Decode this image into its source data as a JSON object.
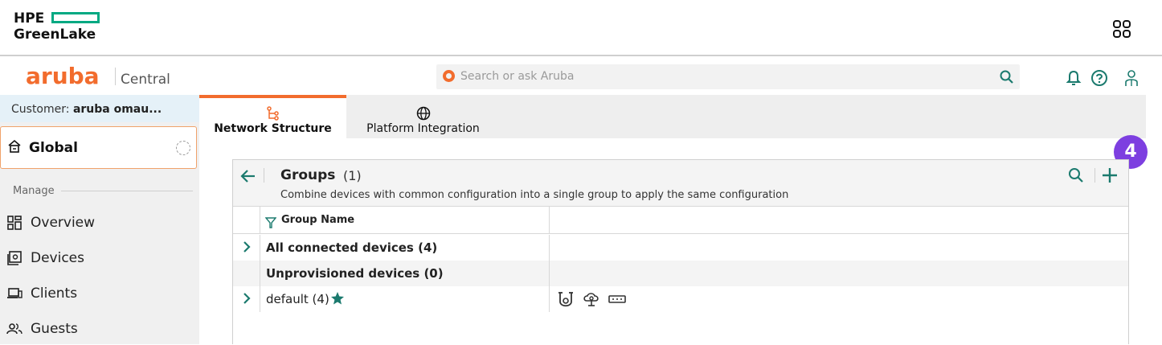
{
  "hpe": {
    "logo_line1": "HPE",
    "logo_line2": "GreenLake",
    "accent": "#01a982"
  },
  "aruba": {
    "brand": "aruba",
    "product": "Central",
    "search_placeholder": "Search or ask Aruba",
    "brand_color": "#f26c2d"
  },
  "header_icons": [
    "apps-grid-icon",
    "bell-icon",
    "help-icon",
    "user-icon"
  ],
  "sidebar": {
    "customer_prefix": "Customer: ",
    "customer_name": "aruba omau...",
    "scope": "Global",
    "section": "Manage",
    "items": [
      {
        "label": "Overview",
        "icon": "overview-grid-icon"
      },
      {
        "label": "Devices",
        "icon": "devices-icon"
      },
      {
        "label": "Clients",
        "icon": "clients-icon"
      },
      {
        "label": "Guests",
        "icon": "guests-icon"
      }
    ]
  },
  "tabs": [
    {
      "label": "Network Structure",
      "icon": "hierarchy-icon",
      "active": true
    },
    {
      "label": "Platform Integration",
      "icon": "globe-icon",
      "active": false
    }
  ],
  "badge": "4",
  "groups": {
    "title": "Groups",
    "count": "(1)",
    "description": "Combine devices with common configuration into a single group to apply the same configuration",
    "column_header": "Group Name",
    "rows": [
      {
        "name": "All connected devices (4)",
        "bold": true,
        "expandable": true
      },
      {
        "name": "Unprovisioned devices (0)",
        "bold": true,
        "expandable": false
      },
      {
        "name": "default (4)",
        "bold": false,
        "expandable": true,
        "starred": true,
        "device_types": [
          "access-point-icon",
          "gateway-icon",
          "switch-icon"
        ]
      }
    ]
  },
  "colors": {
    "teal": "#1b7a6e",
    "badge": "#7d3fe0",
    "sidebar_bg": "#f0f0f0"
  }
}
